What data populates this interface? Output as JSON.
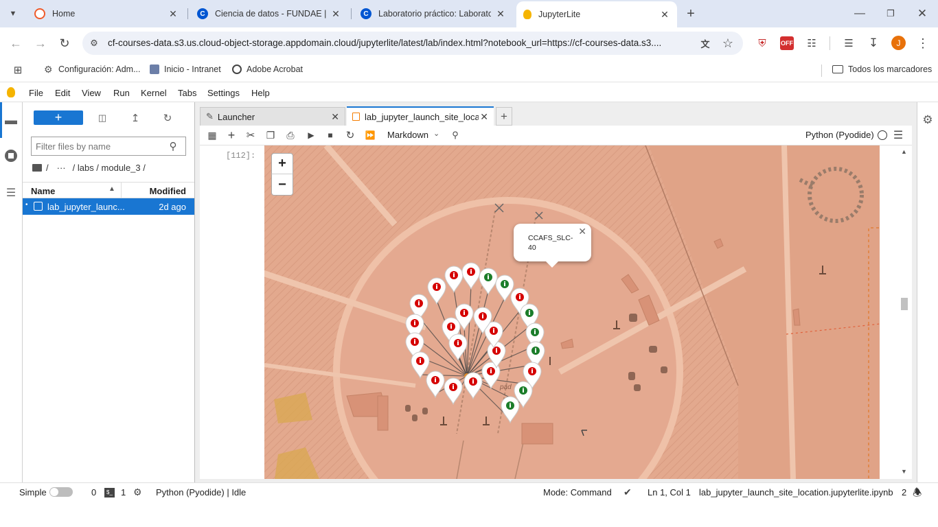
{
  "browser": {
    "tabs": [
      {
        "title": "Home",
        "favicon": "coursera-icon",
        "color": "#ef5a2a"
      },
      {
        "title": "Ciencia de datos - FUNDAE | Co",
        "favicon": "coursera-icon",
        "color": "#0056d2"
      },
      {
        "title": "Laboratorio práctico: Laborator",
        "favicon": "coursera-icon",
        "color": "#0056d2"
      },
      {
        "title": "JupyterLite",
        "favicon": "jupyter-icon",
        "color": "#f5b400"
      }
    ],
    "new_tab": "+",
    "url": "cf-courses-data.s3.us.cloud-object-storage.appdomain.cloud/jupyterlite/latest/lab/index.html?notebook_url=https://cf-courses-data.s3....",
    "profile_initial": "J",
    "bookmarks": [
      {
        "label": "Configuración: Adm..."
      },
      {
        "label": "Inicio - Intranet"
      },
      {
        "label": "Adobe Acrobat"
      }
    ],
    "all_bookmarks": "Todos los marcadores"
  },
  "jupyter": {
    "menu": [
      "File",
      "Edit",
      "View",
      "Run",
      "Kernel",
      "Tabs",
      "Settings",
      "Help"
    ],
    "filebrowser": {
      "new_button": "+",
      "filter_placeholder": "Filter files by name",
      "breadcrumb": [
        "/",
        "···",
        "/ labs / module_3 /"
      ],
      "col_name": "Name",
      "col_modified": "Modified",
      "files": [
        {
          "name": "lab_jupyter_launc...",
          "modified": "2d ago"
        }
      ]
    },
    "tabs": [
      {
        "label": "Launcher"
      },
      {
        "label": "lab_jupyter_launch_site_locat"
      }
    ],
    "add_tab": "+",
    "notebook": {
      "cell_type": "Markdown",
      "kernel": "Python (Pyodide)",
      "prompt": "[112]:"
    },
    "map": {
      "zoom_in": "+",
      "zoom_out": "−",
      "popup_text": "CCAFS_SLC-40",
      "pad_label": "pad",
      "marker_counts": {
        "red": 26,
        "green": 10
      }
    },
    "status": {
      "simple": "Simple",
      "terminals": "0",
      "kernels": "1",
      "kernel_status": "Python (Pyodide) | Idle",
      "mode": "Mode: Command",
      "cursor": "Ln 1, Col 1",
      "filename": "lab_jupyter_launch_site_location.jupyterlite.ipynb",
      "notifications": "2"
    }
  },
  "colors": {
    "accent": "#1976d2",
    "marker_red": "#d50000",
    "marker_green": "#1b7d2a"
  }
}
